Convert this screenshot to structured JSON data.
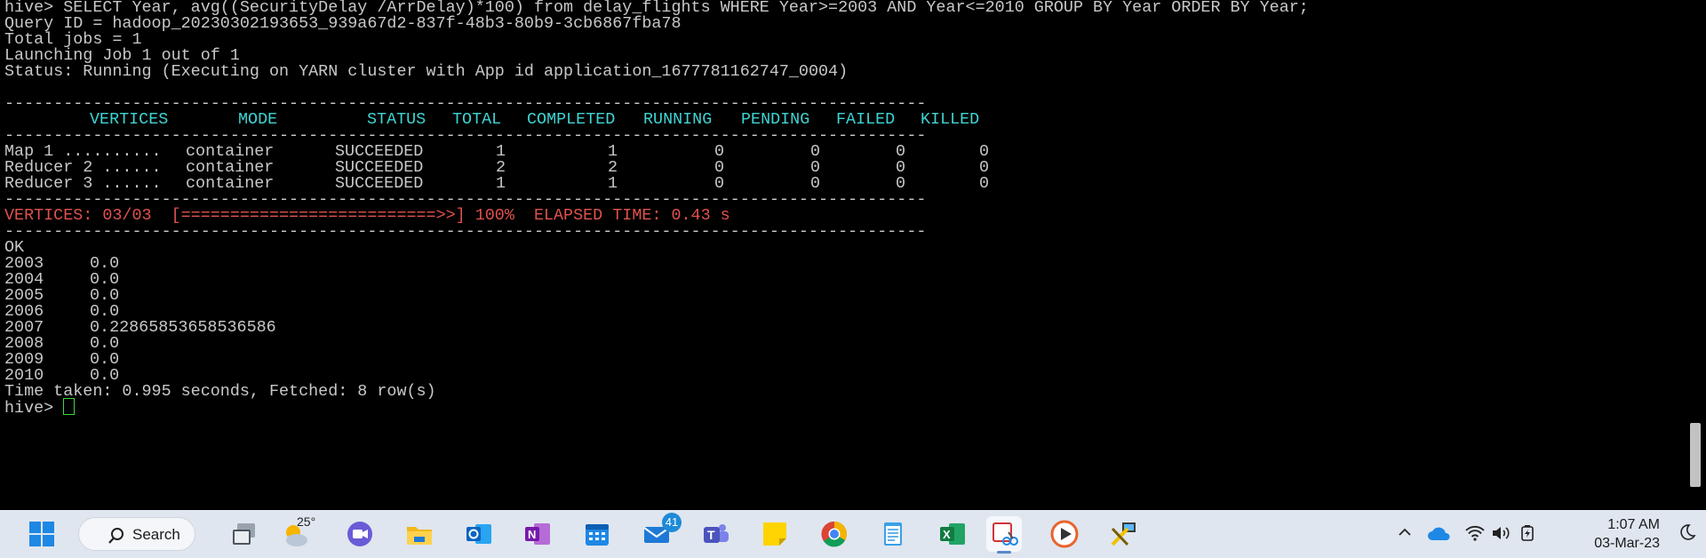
{
  "terminal": {
    "cmd_line": "hive> SELECT Year, avg((SecurityDelay /ArrDelay)*100) from delay_flights WHERE Year>=2003 AND Year<=2010 GROUP BY Year ORDER BY Year;",
    "query_id": "Query ID = hadoop_20230302193653_939a67d2-837f-48b3-80b9-3cb6867fba78",
    "total_jobs": "Total jobs = 1",
    "launching": "Launching Job 1 out of 1",
    "status": "Status: Running (Executing on YARN cluster with App id application_1677781162747_0004)",
    "divider": "----------------------------------------------------------------------------------------------",
    "table_headers": [
      "VERTICES",
      "MODE",
      "STATUS",
      "TOTAL",
      "COMPLETED",
      "RUNNING",
      "PENDING",
      "FAILED",
      "KILLED"
    ],
    "rows": [
      {
        "vertex": "Map 1 ..........",
        "mode": "container",
        "status": "SUCCEEDED",
        "total": "1",
        "completed": "1",
        "running": "0",
        "pending": "0",
        "failed": "0",
        "killed": "0"
      },
      {
        "vertex": "Reducer 2 ......",
        "mode": "container",
        "status": "SUCCEEDED",
        "total": "2",
        "completed": "2",
        "running": "0",
        "pending": "0",
        "failed": "0",
        "killed": "0"
      },
      {
        "vertex": "Reducer 3 ......",
        "mode": "container",
        "status": "SUCCEEDED",
        "total": "1",
        "completed": "1",
        "running": "0",
        "pending": "0",
        "failed": "0",
        "killed": "0"
      }
    ],
    "progress_line": "VERTICES: 03/03  [==========================>>] 100%  ELAPSED TIME: 0.43 s",
    "ok": "OK",
    "results": [
      {
        "year": "2003",
        "value": "0.0"
      },
      {
        "year": "2004",
        "value": "0.0"
      },
      {
        "year": "2005",
        "value": "0.0"
      },
      {
        "year": "2006",
        "value": "0.0"
      },
      {
        "year": "2007",
        "value": "0.22865853658536586"
      },
      {
        "year": "2008",
        "value": "0.0"
      },
      {
        "year": "2009",
        "value": "0.0"
      },
      {
        "year": "2010",
        "value": "0.0"
      }
    ],
    "time_taken": "Time taken: 0.995 seconds, Fetched: 8 row(s)",
    "prompt": "hive> "
  },
  "taskbar": {
    "search_label": "Search",
    "weather_temp": "25°",
    "mail_badge": "41",
    "time": "1:07 AM",
    "date": "03-Mar-23",
    "icons": [
      "windows-start-icon",
      "search-icon",
      "task-view-icon",
      "weather-icon",
      "camera-chat-icon",
      "file-explorer-icon",
      "outlook-icon",
      "onenote-icon",
      "calendar-icon",
      "mail-icon",
      "teams-icon",
      "sticky-notes-icon",
      "chrome-icon",
      "notepad-icon",
      "excel-icon",
      "snipping-tool-icon",
      "media-player-icon",
      "network-tools-icon"
    ]
  },
  "colors": {
    "terminal_bg": "#000000",
    "terminal_text": "#c8c8c8",
    "header_cyan": "#3fd3d3",
    "progress_red": "#e0524d",
    "cursor_green": "#3bd93b",
    "taskbar_bg": "#dfe6ef"
  }
}
